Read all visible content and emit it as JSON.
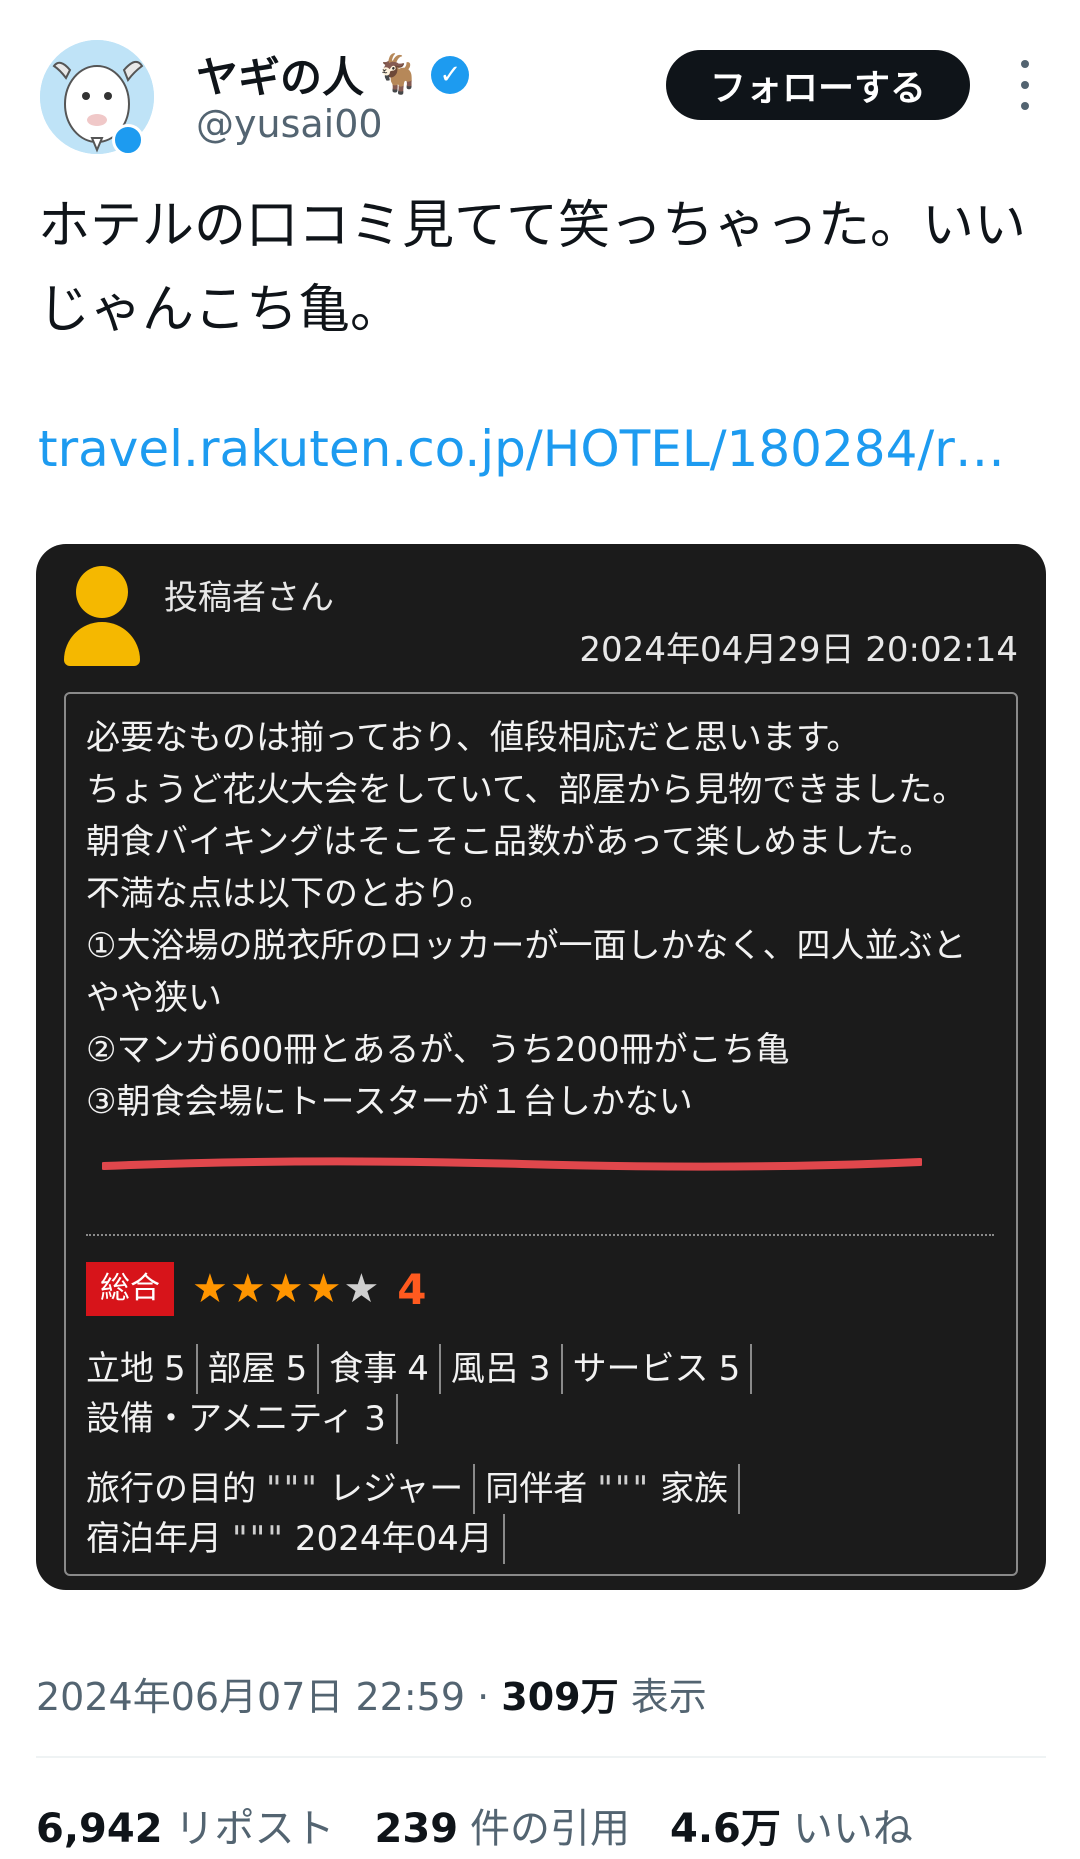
{
  "user": {
    "display_name": "ヤギの人",
    "name_emoji": "🐐",
    "handle": "@yusai00",
    "avatar_icon": "goat-avatar-icon",
    "verified_icon": "verified-badge-icon"
  },
  "actions": {
    "follow_label": "フォローする",
    "more_icon": "more-vertical-icon"
  },
  "tweet": {
    "text": "ホテルの口コミ見てて笑っちゃった。いいじゃんこち亀。",
    "link": "travel.rakuten.co.jp/HOTEL/180284/r…"
  },
  "review": {
    "poster": "投稿者さん",
    "date": "2024年04月29日 20:02:14",
    "lines": [
      "必要なものは揃っており、値段相応だと思います。",
      "ちょうど花火大会をしていて、部屋から見物できました。",
      "朝食バイキングはそこそこ品数があって楽しめました。",
      "不満な点は以下のとおり。",
      "①大浴場の脱衣所のロッカーが一面しかなく、四人並ぶとやや狭い",
      "②マンガ600冊とあるが、うち200冊がこち亀",
      "③朝食会場にトースターが１台しかない"
    ],
    "overall_label": "総合",
    "overall_score": "4",
    "stars_filled": 4,
    "stars_total": 5,
    "ratings": [
      {
        "label": "立地",
        "value": "5"
      },
      {
        "label": "部屋",
        "value": "5"
      },
      {
        "label": "食事",
        "value": "4"
      },
      {
        "label": "風呂",
        "value": "3"
      },
      {
        "label": "サービス",
        "value": "5"
      },
      {
        "label": "設備・アメニティ",
        "value": "3"
      }
    ],
    "meta": [
      {
        "label": "旅行の目的",
        "value": "レジャー"
      },
      {
        "label": "同伴者",
        "value": "家族"
      },
      {
        "label": "宿泊年月",
        "value": "2024年04月"
      }
    ],
    "meta_separator": "\"\"\"",
    "highlight_color": "#e0474c"
  },
  "footer": {
    "timestamp": "2024年06月07日 22:59",
    "dot": "·",
    "views_count": "309万",
    "views_label": "表示",
    "reposts_count": "6,942",
    "reposts_label": "リポスト",
    "quotes_count": "239",
    "quotes_label": "件の引用",
    "likes_count": "4.6万",
    "likes_label": "いいね"
  }
}
